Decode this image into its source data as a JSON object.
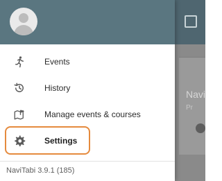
{
  "background": {
    "card_title": "Navi",
    "card_subtitle": "Pr"
  },
  "drawer": {
    "items": [
      {
        "label": "Events",
        "icon": "running-person-icon"
      },
      {
        "label": "History",
        "icon": "history-icon"
      },
      {
        "label": "Manage events & courses",
        "icon": "map-flag-icon"
      },
      {
        "label": "Settings",
        "icon": "gear-icon"
      }
    ],
    "version": "NaviTabi 3.9.1 (185)"
  },
  "colors": {
    "header": "#5a7680",
    "highlight": "#e58a3d"
  }
}
